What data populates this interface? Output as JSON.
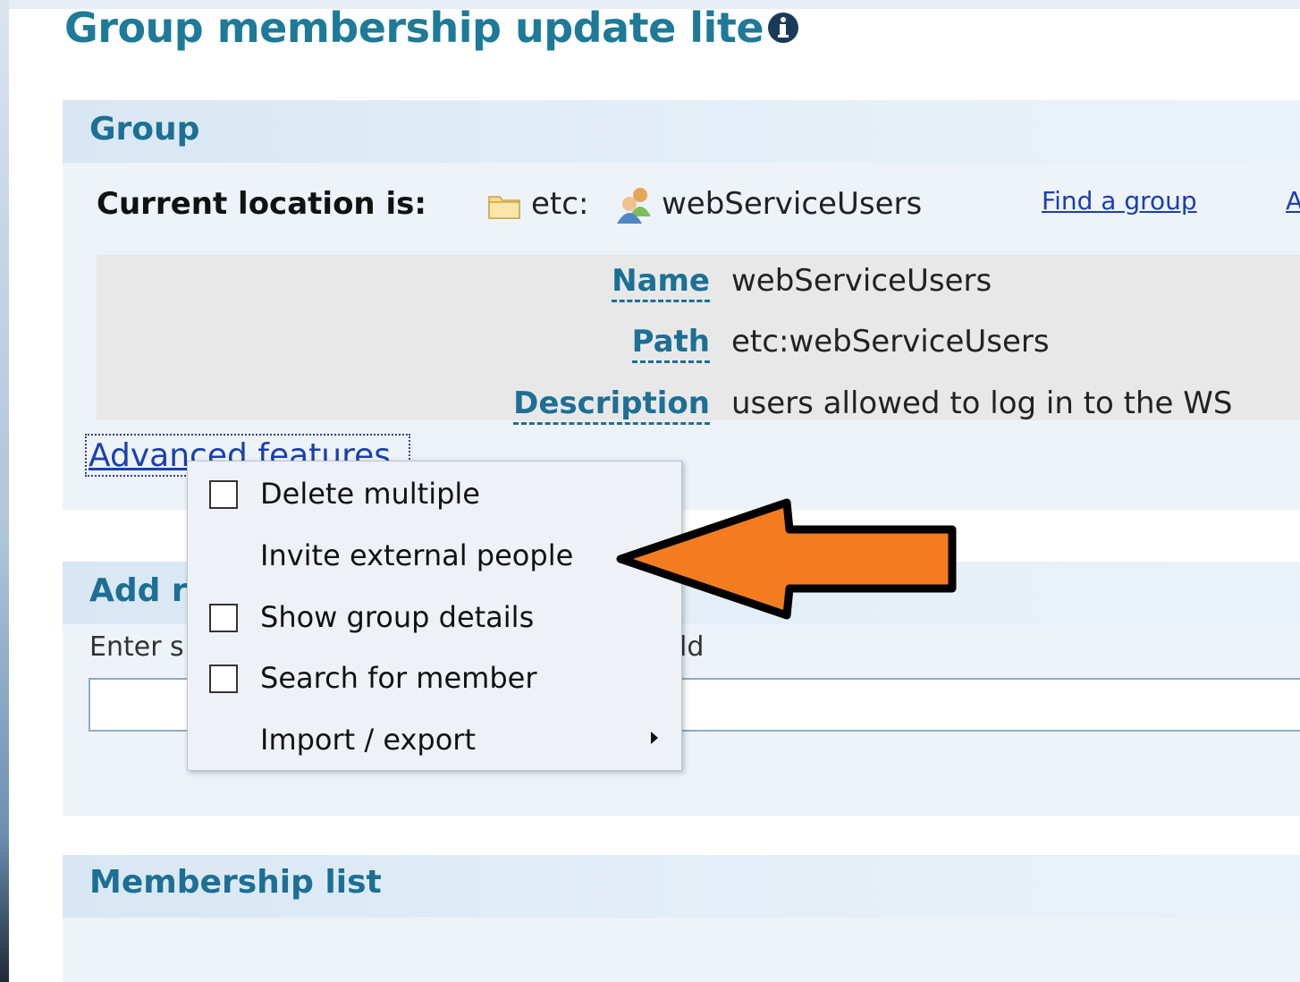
{
  "page": {
    "title": "Group membership update lite"
  },
  "group_section": {
    "title": "Group",
    "location_label": "Current location is:",
    "location_stem": "etc:",
    "location_group": "webServiceUsers",
    "find_link": "Find a group",
    "cut_link": "A"
  },
  "details": {
    "name_label": "Name",
    "name_value": "webServiceUsers",
    "path_label": "Path",
    "path_value": "etc:webServiceUsers",
    "description_label": "Description",
    "description_value": "users allowed to log in to the WS"
  },
  "advanced_link": "Advanced features",
  "add_section": {
    "title": "Add r",
    "hint": "Enter s",
    "hint_right": "ld"
  },
  "menu": {
    "items": [
      {
        "label": "Delete multiple",
        "checkbox": true
      },
      {
        "label": "Invite external people",
        "checkbox": false
      },
      {
        "label": "Show group details",
        "checkbox": true
      },
      {
        "label": "Search for member",
        "checkbox": true
      },
      {
        "label": "Import / export",
        "checkbox": false,
        "submenu": true
      }
    ]
  },
  "membership_section": {
    "title": "Membership list"
  },
  "colors": {
    "heading": "#1d7a98",
    "link": "#1a3fb0",
    "arrow_fill": "#f47c20",
    "section_bg": "#edf3f9"
  }
}
